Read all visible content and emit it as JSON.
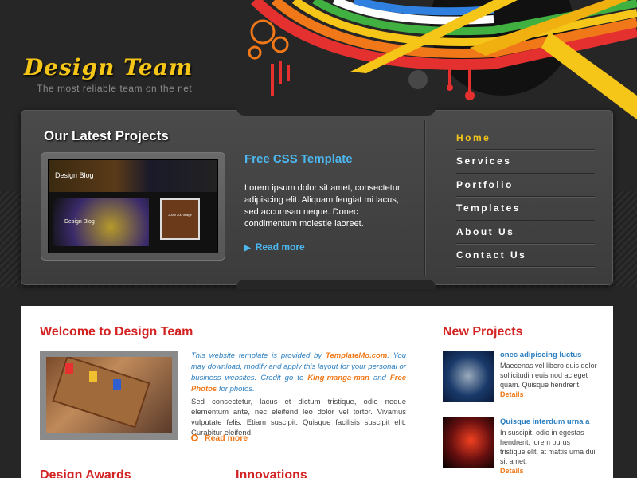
{
  "header": {
    "logo_title": "Design Team",
    "tagline": "The most reliable team on the net"
  },
  "feature": {
    "section_title": "Our Latest Projects",
    "thumb_title": "Design Blog",
    "thumb_subtitle": "Design Blog",
    "thumb_box_text": "200 x 200 image",
    "heading": "Free CSS Template",
    "text": "Lorem ipsum dolor sit amet, consectetur adipiscing elit. Aliquam feugiat mi lacus, sed accumsan neque. Donec condimentum molestie laoreet.",
    "read_more": "Read more"
  },
  "nav": {
    "items": [
      {
        "label": "Home",
        "active": true
      },
      {
        "label": "Services",
        "active": false
      },
      {
        "label": "Portfolio",
        "active": false
      },
      {
        "label": "Templates",
        "active": false
      },
      {
        "label": "About Us",
        "active": false
      },
      {
        "label": "Contact Us",
        "active": false
      }
    ]
  },
  "welcome": {
    "title": "Welcome to Design Team",
    "intro_a": "This website template is provided by ",
    "intro_link1": "TemplateMo.com",
    "intro_b": ". You may download, modify and apply this layout for your personal or business websites. Credit go to ",
    "intro_link2": "King-manga-man",
    "intro_c": " and ",
    "intro_link3": "Free Photos",
    "intro_d": " for photos.",
    "body": "Sed consectetur, lacus et dictum tristique, odio neque elementum ante, nec eleifend leo dolor vel tortor. Vivamus vulputate felis. Etiam suscipit. Quisque facilisis suscipit elit. Curabitur eleifend.",
    "read_more": "Read more"
  },
  "sections": {
    "awards_title": "Design Awards",
    "innovations_title": "Innovations"
  },
  "new_projects": {
    "title": "New Projects",
    "items": [
      {
        "title": "onec adipiscing luctus",
        "text": "Maecenas vel libero quis dolor sollicitudin euismod ac eget quam. Quisque hendrerit.",
        "details": "Details"
      },
      {
        "title": "Quisque interdum urna a",
        "text": "In suscipit, odio in egestas hendrerit, lorem purus tristique elit, at mattis urna dui sit amet.",
        "details": "Details"
      }
    ]
  },
  "colors": {
    "background": "#262626",
    "logo_gold": "#f5c518",
    "accent_blue": "#4db8f0",
    "heading_red": "#d32222",
    "link_orange": "#f07818"
  }
}
